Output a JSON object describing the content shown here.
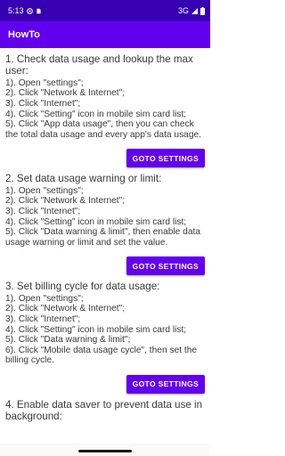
{
  "status_bar": {
    "time": "5:13",
    "network": "3G"
  },
  "app_bar": {
    "title": "HowTo"
  },
  "sections": [
    {
      "title": "1. Check data usage and lookup the max user:",
      "steps": [
        "1). Open \"settings\";",
        "2). Click \"Network & Internet\";",
        "3). Click \"Internet\";",
        "4). Click \"Setting\" icon in mobile sim card list;",
        "5). Click \"App data usage\", then you can check the total data usage and every app's data usage."
      ],
      "button": "GOTO SETTINGS"
    },
    {
      "title": "2. Set data usage warning or limit:",
      "steps": [
        "1). Open \"settings\";",
        "2). Click \"Network & Internet\";",
        "3). Click \"Internet\";",
        "4). Click \"Setting\" icon in mobile sim card list;",
        "5). Click \"Data warning & limit\", then enable data usage warning or limit and set the value."
      ],
      "button": "GOTO SETTINGS"
    },
    {
      "title": "3. Set billing cycle for data usage:",
      "steps": [
        "1). Open \"settings\";",
        "2). Click \"Network & Internet\";",
        "3). Click \"Internet\";",
        "4). Click \"Setting\" icon in mobile sim card list;",
        "5). Click  \"Data warning & limit\";",
        "6). Click \"Mobile data usage cycle\", then set the billing cycle."
      ],
      "button": "GOTO SETTINGS"
    },
    {
      "title": "4. Enable data saver to prevent data use in background:",
      "steps": []
    }
  ]
}
